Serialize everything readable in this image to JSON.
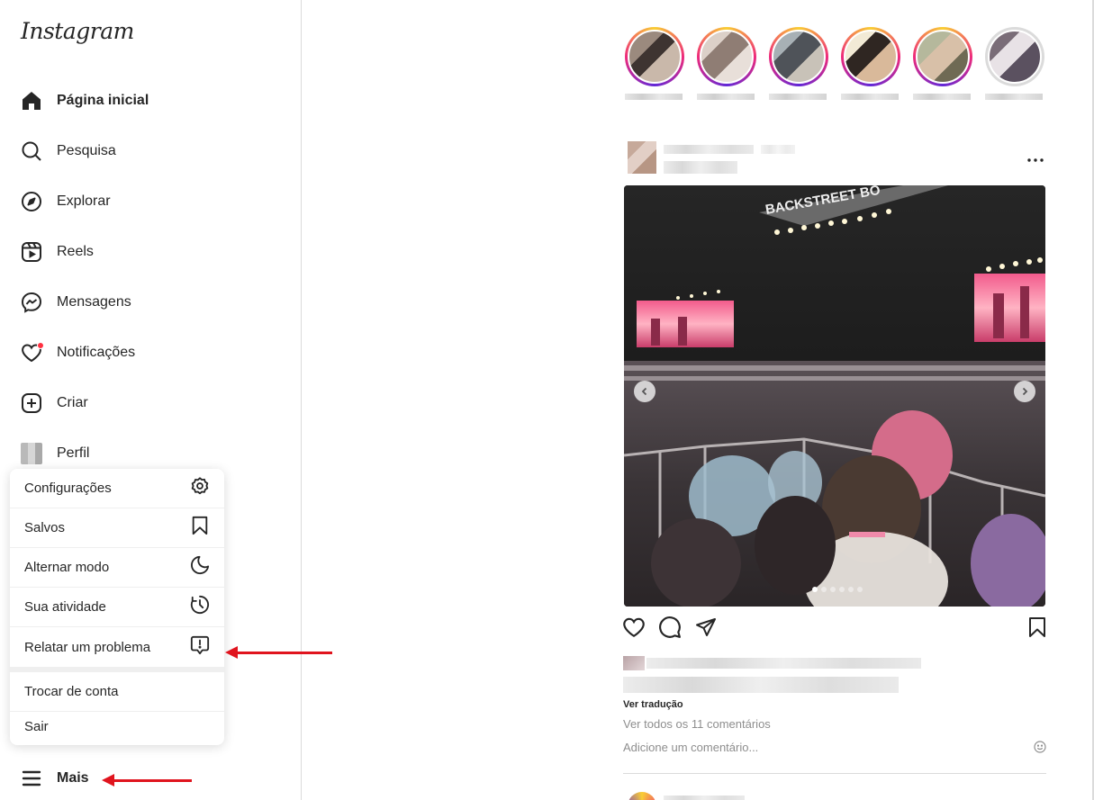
{
  "sidebar": {
    "logo": "Instagram",
    "items": [
      {
        "label": "Página inicial",
        "icon": "home-icon"
      },
      {
        "label": "Pesquisa",
        "icon": "search-icon"
      },
      {
        "label": "Explorar",
        "icon": "compass-icon"
      },
      {
        "label": "Reels",
        "icon": "reels-icon"
      },
      {
        "label": "Mensagens",
        "icon": "messenger-icon"
      },
      {
        "label": "Notificações",
        "icon": "heart-icon"
      },
      {
        "label": "Criar",
        "icon": "plus-square-icon"
      },
      {
        "label": "Perfil",
        "icon": "avatar"
      }
    ],
    "more_label": "Mais"
  },
  "more_menu": {
    "items": [
      {
        "label": "Configurações",
        "icon": "settings-icon"
      },
      {
        "label": "Salvos",
        "icon": "bookmark-icon"
      },
      {
        "label": "Alternar modo",
        "icon": "moon-icon"
      },
      {
        "label": "Sua atividade",
        "icon": "activity-icon"
      },
      {
        "label": "Relatar um problema",
        "icon": "report-icon"
      },
      {
        "label": "Trocar de conta",
        "icon": ""
      },
      {
        "label": "Sair",
        "icon": ""
      }
    ]
  },
  "post": {
    "photo_banner_text": "BACKSTREET BO",
    "see_translation": "Ver tradução",
    "see_all_comments": "Ver todos os 11 comentários",
    "add_comment_placeholder": "Adicione um comentário...",
    "carousel_count": 6,
    "carousel_index": 1
  },
  "colors": {
    "annotation_arrow": "#e0141e",
    "notification_dot": "#ff3040",
    "border": "#dbdbdb",
    "muted_text": "#8e8e8e"
  }
}
